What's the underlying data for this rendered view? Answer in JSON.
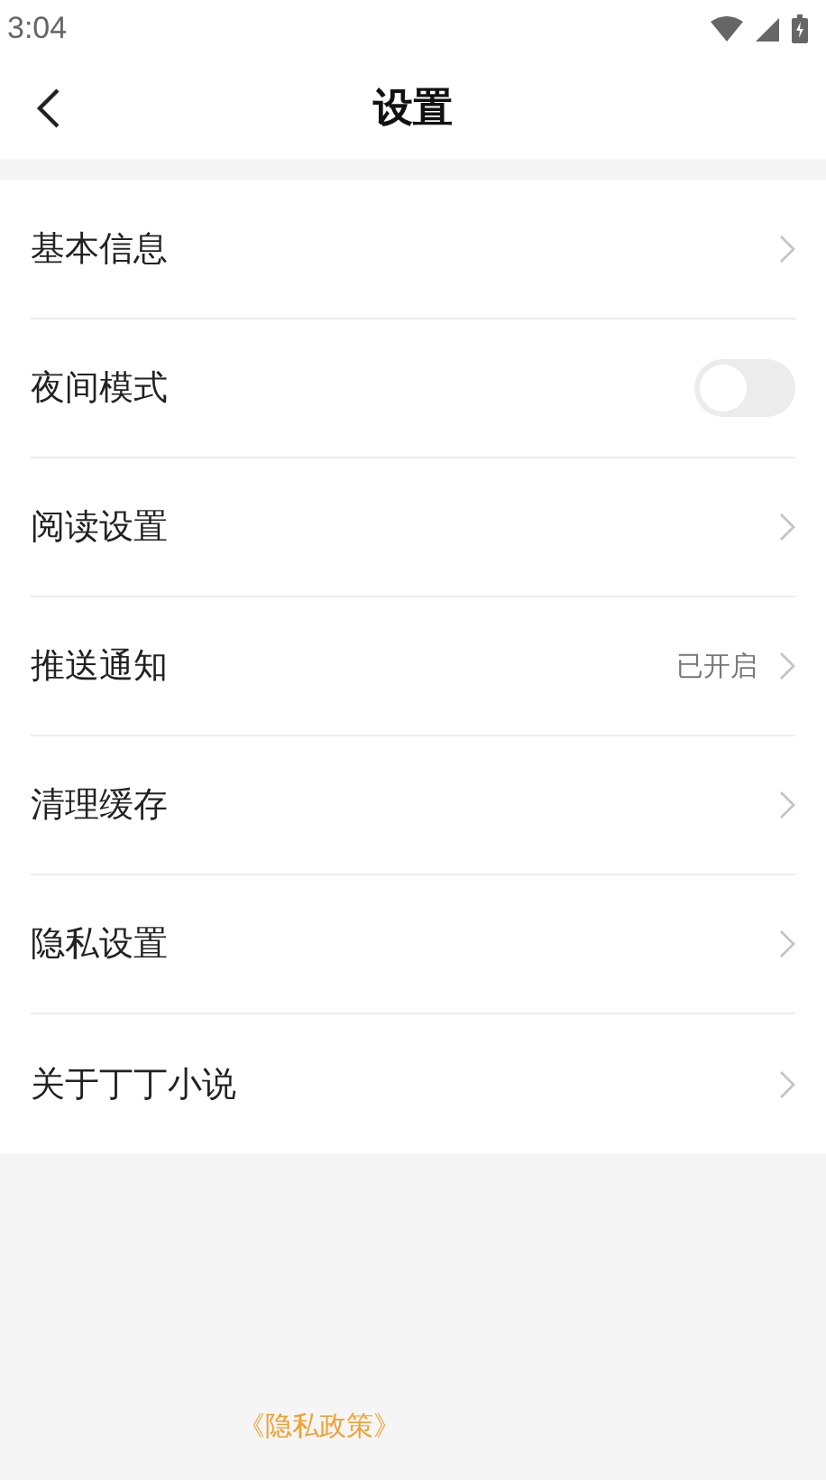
{
  "status_bar": {
    "time": "3:04"
  },
  "header": {
    "title": "设置"
  },
  "settings": [
    {
      "kind": "link",
      "label": "基本信息"
    },
    {
      "kind": "toggle",
      "label": "夜间模式",
      "on": false
    },
    {
      "kind": "link",
      "label": "阅读设置"
    },
    {
      "kind": "link",
      "label": "推送通知",
      "value": "已开启"
    },
    {
      "kind": "link",
      "label": "清理缓存"
    },
    {
      "kind": "link",
      "label": "隐私设置"
    },
    {
      "kind": "link",
      "label": "关于丁丁小说"
    }
  ],
  "footer_links": [
    "《隐私政策》"
  ]
}
